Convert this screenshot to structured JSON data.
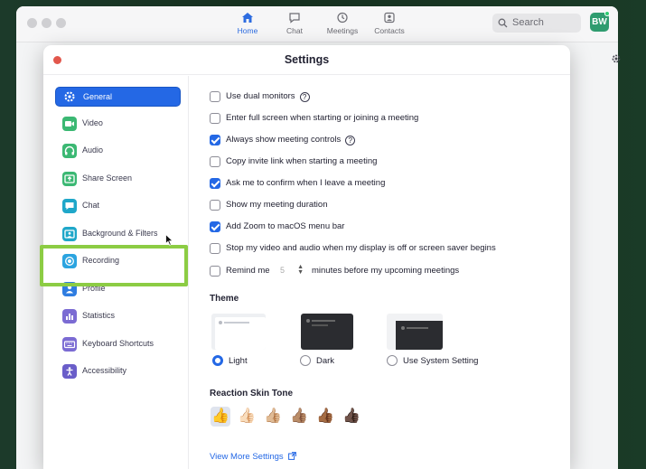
{
  "window": {
    "nav": [
      {
        "label": "Home",
        "icon": "home-icon",
        "active": true
      },
      {
        "label": "Chat",
        "icon": "chat-icon",
        "active": false
      },
      {
        "label": "Meetings",
        "icon": "clock-icon",
        "active": false
      },
      {
        "label": "Contacts",
        "icon": "contacts-icon",
        "active": false
      }
    ],
    "search_label": "Search",
    "avatar_initials": "BW"
  },
  "dialog": {
    "title": "Settings"
  },
  "sidebar": {
    "items": [
      {
        "label": "General",
        "icon": "gear-icon",
        "color": "#2468e5",
        "active": true
      },
      {
        "label": "Video",
        "icon": "video-icon",
        "color": "#3bb873"
      },
      {
        "label": "Audio",
        "icon": "headphones-icon",
        "color": "#3bb873"
      },
      {
        "label": "Share Screen",
        "icon": "share-screen-icon",
        "color": "#3bb873"
      },
      {
        "label": "Chat",
        "icon": "chat-icon",
        "color": "#1fa7c9"
      },
      {
        "label": "Background & Filters",
        "icon": "background-icon",
        "color": "#1fa7c9"
      },
      {
        "label": "Recording",
        "icon": "record-icon",
        "color": "#2ba4e0"
      },
      {
        "label": "Profile",
        "icon": "profile-icon",
        "color": "#2f7de1"
      },
      {
        "label": "Statistics",
        "icon": "statistics-icon",
        "color": "#7b6bd3"
      },
      {
        "label": "Keyboard Shortcuts",
        "icon": "keyboard-icon",
        "color": "#7b6bd3"
      },
      {
        "label": "Accessibility",
        "icon": "accessibility-icon",
        "color": "#6a5ec9"
      }
    ]
  },
  "general": {
    "options": [
      {
        "label": "Use dual monitors",
        "checked": false,
        "help": true
      },
      {
        "label": "Enter full screen when starting or joining a meeting",
        "checked": false
      },
      {
        "label": "Always show meeting controls",
        "checked": true,
        "help": true
      },
      {
        "label": "Copy invite link when starting a meeting",
        "checked": false
      },
      {
        "label": "Ask me to confirm when I leave a meeting",
        "checked": true
      },
      {
        "label": "Show my meeting duration",
        "checked": false
      },
      {
        "label": "Add Zoom to macOS menu bar",
        "checked": true
      },
      {
        "label": "Stop my video and audio when my display is off or screen saver begins",
        "checked": false
      }
    ],
    "remind": {
      "prefix": "Remind me",
      "minutes": "5",
      "suffix": "minutes before my upcoming meetings",
      "checked": false
    },
    "help_glyph": "?",
    "theme_title": "Theme",
    "themes": [
      {
        "label": "Light",
        "selected": true
      },
      {
        "label": "Dark",
        "selected": false
      },
      {
        "label": "Use System Setting",
        "selected": false
      }
    ],
    "skin_title": "Reaction Skin Tone",
    "skin_tones": [
      "👍",
      "👍🏻",
      "👍🏼",
      "👍🏽",
      "👍🏾",
      "👍🏿"
    ],
    "more_link": "View More Settings",
    "colors": {
      "accent": "#2468e5",
      "highlight": "#8ccc44"
    }
  }
}
